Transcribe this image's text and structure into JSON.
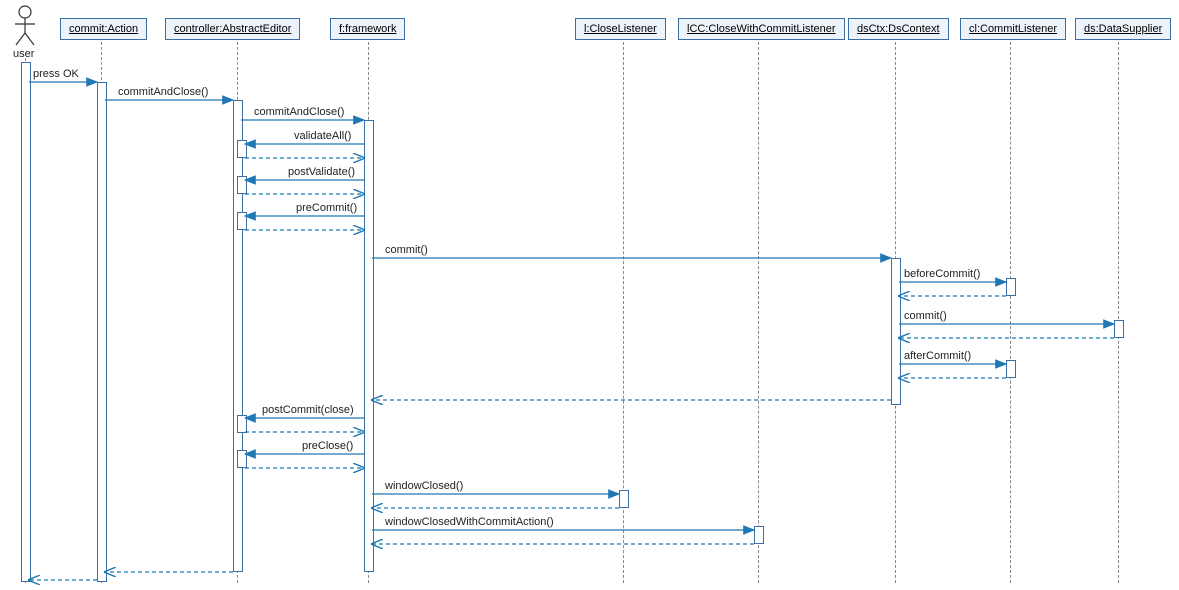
{
  "actor": {
    "name": "user"
  },
  "participants": {
    "commit": "commit:Action",
    "controller": "controller:AbstractEditor",
    "framework": "f:framework",
    "closeListener": "l:CloseListener",
    "commitCloseListener": "lCC:CloseWithCommitListener",
    "dsContext": "dsCtx:DsContext",
    "commitListener": "cl:CommitListener",
    "dataSupplier": "ds:DataSupplier"
  },
  "messages": {
    "pressOK": "press OK",
    "commitAndClose1": "commitAndClose()",
    "commitAndClose2": "commitAndClose()",
    "validateAll": "validateAll()",
    "postValidate": "postValidate()",
    "preCommit": "preCommit()",
    "commit": "commit()",
    "beforeCommit": "beforeCommit()",
    "commitDS": "commit()",
    "afterCommit": "afterCommit()",
    "postCommit": "postCommit(close)",
    "preClose": "preClose()",
    "windowClosed": "windowClosed()",
    "windowClosedWithCommit": "windowClosedWithCommitAction()"
  }
}
